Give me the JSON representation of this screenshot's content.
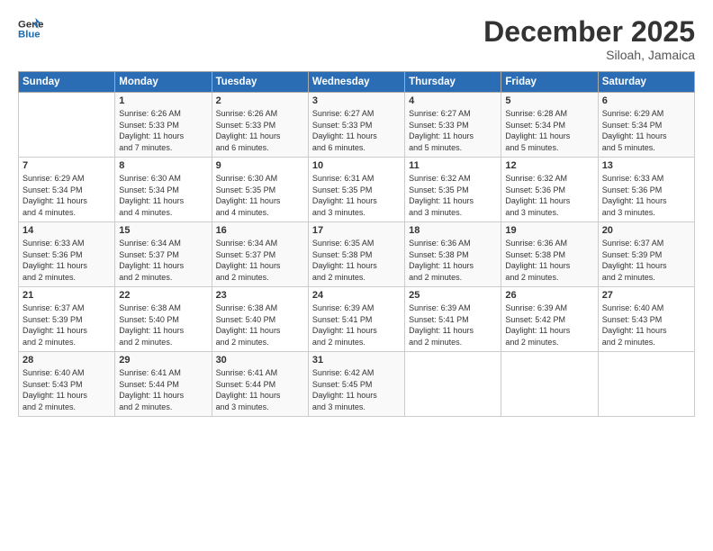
{
  "logo": {
    "line1": "General",
    "line2": "Blue"
  },
  "title": "December 2025",
  "subtitle": "Siloah, Jamaica",
  "days_of_week": [
    "Sunday",
    "Monday",
    "Tuesday",
    "Wednesday",
    "Thursday",
    "Friday",
    "Saturday"
  ],
  "weeks": [
    [
      {
        "day": "",
        "info": ""
      },
      {
        "day": "1",
        "info": "Sunrise: 6:26 AM\nSunset: 5:33 PM\nDaylight: 11 hours\nand 7 minutes."
      },
      {
        "day": "2",
        "info": "Sunrise: 6:26 AM\nSunset: 5:33 PM\nDaylight: 11 hours\nand 6 minutes."
      },
      {
        "day": "3",
        "info": "Sunrise: 6:27 AM\nSunset: 5:33 PM\nDaylight: 11 hours\nand 6 minutes."
      },
      {
        "day": "4",
        "info": "Sunrise: 6:27 AM\nSunset: 5:33 PM\nDaylight: 11 hours\nand 5 minutes."
      },
      {
        "day": "5",
        "info": "Sunrise: 6:28 AM\nSunset: 5:34 PM\nDaylight: 11 hours\nand 5 minutes."
      },
      {
        "day": "6",
        "info": "Sunrise: 6:29 AM\nSunset: 5:34 PM\nDaylight: 11 hours\nand 5 minutes."
      }
    ],
    [
      {
        "day": "7",
        "info": "Sunrise: 6:29 AM\nSunset: 5:34 PM\nDaylight: 11 hours\nand 4 minutes."
      },
      {
        "day": "8",
        "info": "Sunrise: 6:30 AM\nSunset: 5:34 PM\nDaylight: 11 hours\nand 4 minutes."
      },
      {
        "day": "9",
        "info": "Sunrise: 6:30 AM\nSunset: 5:35 PM\nDaylight: 11 hours\nand 4 minutes."
      },
      {
        "day": "10",
        "info": "Sunrise: 6:31 AM\nSunset: 5:35 PM\nDaylight: 11 hours\nand 3 minutes."
      },
      {
        "day": "11",
        "info": "Sunrise: 6:32 AM\nSunset: 5:35 PM\nDaylight: 11 hours\nand 3 minutes."
      },
      {
        "day": "12",
        "info": "Sunrise: 6:32 AM\nSunset: 5:36 PM\nDaylight: 11 hours\nand 3 minutes."
      },
      {
        "day": "13",
        "info": "Sunrise: 6:33 AM\nSunset: 5:36 PM\nDaylight: 11 hours\nand 3 minutes."
      }
    ],
    [
      {
        "day": "14",
        "info": "Sunrise: 6:33 AM\nSunset: 5:36 PM\nDaylight: 11 hours\nand 2 minutes."
      },
      {
        "day": "15",
        "info": "Sunrise: 6:34 AM\nSunset: 5:37 PM\nDaylight: 11 hours\nand 2 minutes."
      },
      {
        "day": "16",
        "info": "Sunrise: 6:34 AM\nSunset: 5:37 PM\nDaylight: 11 hours\nand 2 minutes."
      },
      {
        "day": "17",
        "info": "Sunrise: 6:35 AM\nSunset: 5:38 PM\nDaylight: 11 hours\nand 2 minutes."
      },
      {
        "day": "18",
        "info": "Sunrise: 6:36 AM\nSunset: 5:38 PM\nDaylight: 11 hours\nand 2 minutes."
      },
      {
        "day": "19",
        "info": "Sunrise: 6:36 AM\nSunset: 5:38 PM\nDaylight: 11 hours\nand 2 minutes."
      },
      {
        "day": "20",
        "info": "Sunrise: 6:37 AM\nSunset: 5:39 PM\nDaylight: 11 hours\nand 2 minutes."
      }
    ],
    [
      {
        "day": "21",
        "info": "Sunrise: 6:37 AM\nSunset: 5:39 PM\nDaylight: 11 hours\nand 2 minutes."
      },
      {
        "day": "22",
        "info": "Sunrise: 6:38 AM\nSunset: 5:40 PM\nDaylight: 11 hours\nand 2 minutes."
      },
      {
        "day": "23",
        "info": "Sunrise: 6:38 AM\nSunset: 5:40 PM\nDaylight: 11 hours\nand 2 minutes."
      },
      {
        "day": "24",
        "info": "Sunrise: 6:39 AM\nSunset: 5:41 PM\nDaylight: 11 hours\nand 2 minutes."
      },
      {
        "day": "25",
        "info": "Sunrise: 6:39 AM\nSunset: 5:41 PM\nDaylight: 11 hours\nand 2 minutes."
      },
      {
        "day": "26",
        "info": "Sunrise: 6:39 AM\nSunset: 5:42 PM\nDaylight: 11 hours\nand 2 minutes."
      },
      {
        "day": "27",
        "info": "Sunrise: 6:40 AM\nSunset: 5:43 PM\nDaylight: 11 hours\nand 2 minutes."
      }
    ],
    [
      {
        "day": "28",
        "info": "Sunrise: 6:40 AM\nSunset: 5:43 PM\nDaylight: 11 hours\nand 2 minutes."
      },
      {
        "day": "29",
        "info": "Sunrise: 6:41 AM\nSunset: 5:44 PM\nDaylight: 11 hours\nand 2 minutes."
      },
      {
        "day": "30",
        "info": "Sunrise: 6:41 AM\nSunset: 5:44 PM\nDaylight: 11 hours\nand 3 minutes."
      },
      {
        "day": "31",
        "info": "Sunrise: 6:42 AM\nSunset: 5:45 PM\nDaylight: 11 hours\nand 3 minutes."
      },
      {
        "day": "",
        "info": ""
      },
      {
        "day": "",
        "info": ""
      },
      {
        "day": "",
        "info": ""
      }
    ]
  ]
}
